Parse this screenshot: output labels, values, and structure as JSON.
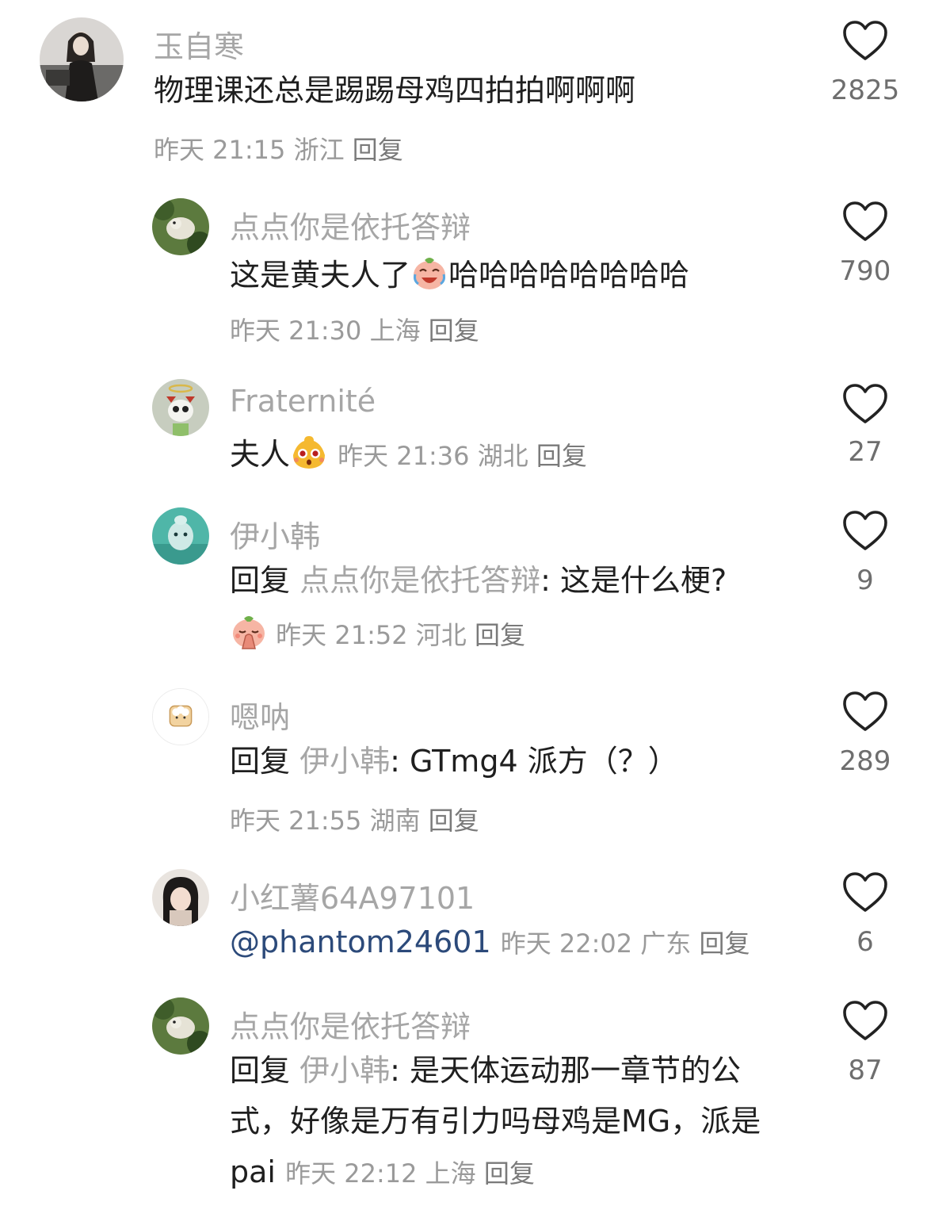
{
  "comments": [
    {
      "user": "玉自寒",
      "text": "物理课还总是踢踢母鸡四拍拍啊啊啊",
      "time": "昨天 21:15",
      "location": "浙江",
      "reply_label": "回复",
      "likes": "2825"
    },
    {
      "user": "点点你是依托答辩",
      "text_before": "这是黄夫人了",
      "text_after": "哈哈哈哈哈哈哈哈",
      "emoji": "laughing-crying-emoji",
      "time": "昨天 21:30",
      "location": "上海",
      "reply_label": "回复",
      "likes": "790"
    },
    {
      "user": "Fraternité",
      "text": "夫人",
      "emoji": "surprised-face-emoji",
      "time": "昨天 21:36",
      "location": "湖北",
      "reply_label": "回复",
      "likes": "27"
    },
    {
      "user": "伊小韩",
      "reply_prefix": "回复",
      "reply_target": "点点你是依托答辩",
      "text": ": 这是什么梗?",
      "emoji": "praying-face-emoji",
      "time": "昨天 21:52",
      "location": "河北",
      "reply_label": "回复",
      "likes": "9"
    },
    {
      "user": "嗯呐",
      "reply_prefix": "回复",
      "reply_target": "伊小韩",
      "text": ": GTmg4 派方（？）",
      "time": "昨天 21:55",
      "location": "湖南",
      "reply_label": "回复",
      "likes": "289"
    },
    {
      "user": "小红薯64A97101",
      "mention": "@phantom24601",
      "time": "昨天 22:02",
      "location": "广东",
      "reply_label": "回复",
      "likes": "6"
    },
    {
      "user": "点点你是依托答辩",
      "reply_prefix": "回复",
      "reply_target": "伊小韩",
      "text": ": 是天体运动那一章节的公式，好像是万有引力吗母鸡是MG，派是pai",
      "time": "昨天 22:12",
      "location": "上海",
      "reply_label": "回复",
      "likes": "87"
    }
  ],
  "icons": {
    "like": "heart-outline-icon"
  },
  "colors": {
    "username": "#a6a6a6",
    "text": "#1f1f1f",
    "meta": "#9a9a9a",
    "mention": "#2c4a7a"
  }
}
